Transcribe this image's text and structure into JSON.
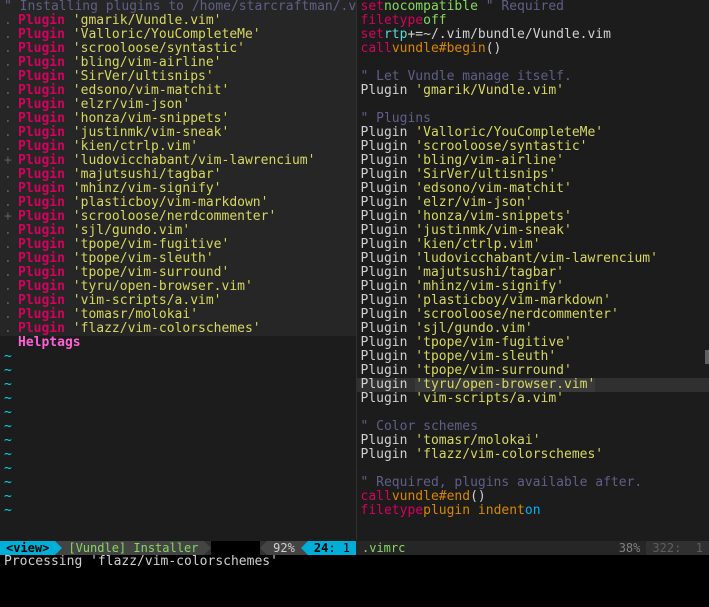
{
  "left": {
    "comment_top": "\" Installing plugins to /home/starcraftman/.vim/bundle",
    "gutters": [
      ".",
      "",
      ".",
      ".",
      ".",
      ".",
      ".",
      ".",
      ".",
      ".",
      ".",
      "+",
      ".",
      ".",
      ".",
      "+",
      ".",
      ".",
      ".",
      ".",
      ".",
      ".",
      ".",
      ".",
      ">"
    ],
    "plugins": [
      "gmarik/Vundle.vim",
      "Valloric/YouCompleteMe",
      "scrooloose/syntastic",
      "bling/vim-airline",
      "SirVer/ultisnips",
      "edsono/vim-matchit",
      "elzr/vim-json",
      "honza/vim-snippets",
      "justinmk/vim-sneak",
      "kien/ctrlp.vim",
      "ludovicchabant/vim-lawrencium",
      "majutsushi/tagbar",
      "mhinz/vim-signify",
      "plasticboy/vim-markdown",
      "scrooloose/nerdcommenter",
      "sjl/gundo.vim",
      "tpope/vim-fugitive",
      "tpope/vim-sleuth",
      "tpope/vim-surround",
      "tyru/open-browser.vim",
      "vim-scripts/a.vim",
      "tomasr/molokai",
      "flazz/vim-colorschemes"
    ],
    "helptags": "Helptags",
    "status": {
      "mode": "<view>",
      "file": "[Vundle] Installer",
      "pct": "92%",
      "line": "24",
      "col": "1"
    }
  },
  "right": {
    "lines": [
      {
        "t": "kw",
        "a": "set",
        "b": "nocompatible",
        "c": " \" Required"
      },
      {
        "t": "kw",
        "a": "filetype",
        "b": "off"
      },
      {
        "t": "set",
        "a": "set",
        "b": "rtp",
        "c": "+=~/.vim/bundle/Vundle.vim"
      },
      {
        "t": "call",
        "a": "call",
        "b": "vundle#begin",
        "c": "()"
      },
      {
        "t": "blank"
      },
      {
        "t": "comment",
        "a": "\" Let Vundle manage itself."
      },
      {
        "t": "plugin",
        "a": "gmarik/Vundle.vim"
      },
      {
        "t": "blank"
      },
      {
        "t": "comment",
        "a": "\" Plugins"
      },
      {
        "t": "plugin",
        "a": "Valloric/YouCompleteMe"
      },
      {
        "t": "plugin",
        "a": "scrooloose/syntastic"
      },
      {
        "t": "plugin",
        "a": "bling/vim-airline"
      },
      {
        "t": "plugin",
        "a": "SirVer/ultisnips"
      },
      {
        "t": "plugin",
        "a": "edsono/vim-matchit"
      },
      {
        "t": "plugin",
        "a": "elzr/vim-json"
      },
      {
        "t": "plugin",
        "a": "honza/vim-snippets"
      },
      {
        "t": "plugin",
        "a": "justinmk/vim-sneak"
      },
      {
        "t": "plugin",
        "a": "kien/ctrlp.vim"
      },
      {
        "t": "plugin",
        "a": "ludovicchabant/vim-lawrencium"
      },
      {
        "t": "plugin",
        "a": "majutsushi/tagbar"
      },
      {
        "t": "plugin",
        "a": "mhinz/vim-signify"
      },
      {
        "t": "plugin",
        "a": "plasticboy/vim-markdown"
      },
      {
        "t": "plugin",
        "a": "scrooloose/nerdcommenter"
      },
      {
        "t": "plugin",
        "a": "sjl/gundo.vim"
      },
      {
        "t": "plugin",
        "a": "tpope/vim-fugitive"
      },
      {
        "t": "plugin",
        "a": "tpope/vim-sleuth"
      },
      {
        "t": "plugin",
        "a": "tpope/vim-surround"
      },
      {
        "t": "plugin-hl",
        "a": "tyru/open-browser.vim"
      },
      {
        "t": "plugin",
        "a": "vim-scripts/a.vim"
      },
      {
        "t": "blank"
      },
      {
        "t": "comment",
        "a": "\" Color schemes"
      },
      {
        "t": "plugin",
        "a": "tomasr/molokai"
      },
      {
        "t": "plugin",
        "a": "flazz/vim-colorschemes"
      },
      {
        "t": "blank"
      },
      {
        "t": "comment",
        "a": "\" Required, plugins available after."
      },
      {
        "t": "call",
        "a": "call",
        "b": "vundle#end",
        "c": "()"
      },
      {
        "t": "ft",
        "a": "filetype",
        "b": "plugin indent",
        "c": "on"
      }
    ],
    "status": {
      "file": ".vimrc",
      "pct": "38%",
      "line": "322",
      "col": "1"
    }
  },
  "cmd": "Processing 'flazz/vim-colorschemes'",
  "kw_plugin": "Plugin"
}
